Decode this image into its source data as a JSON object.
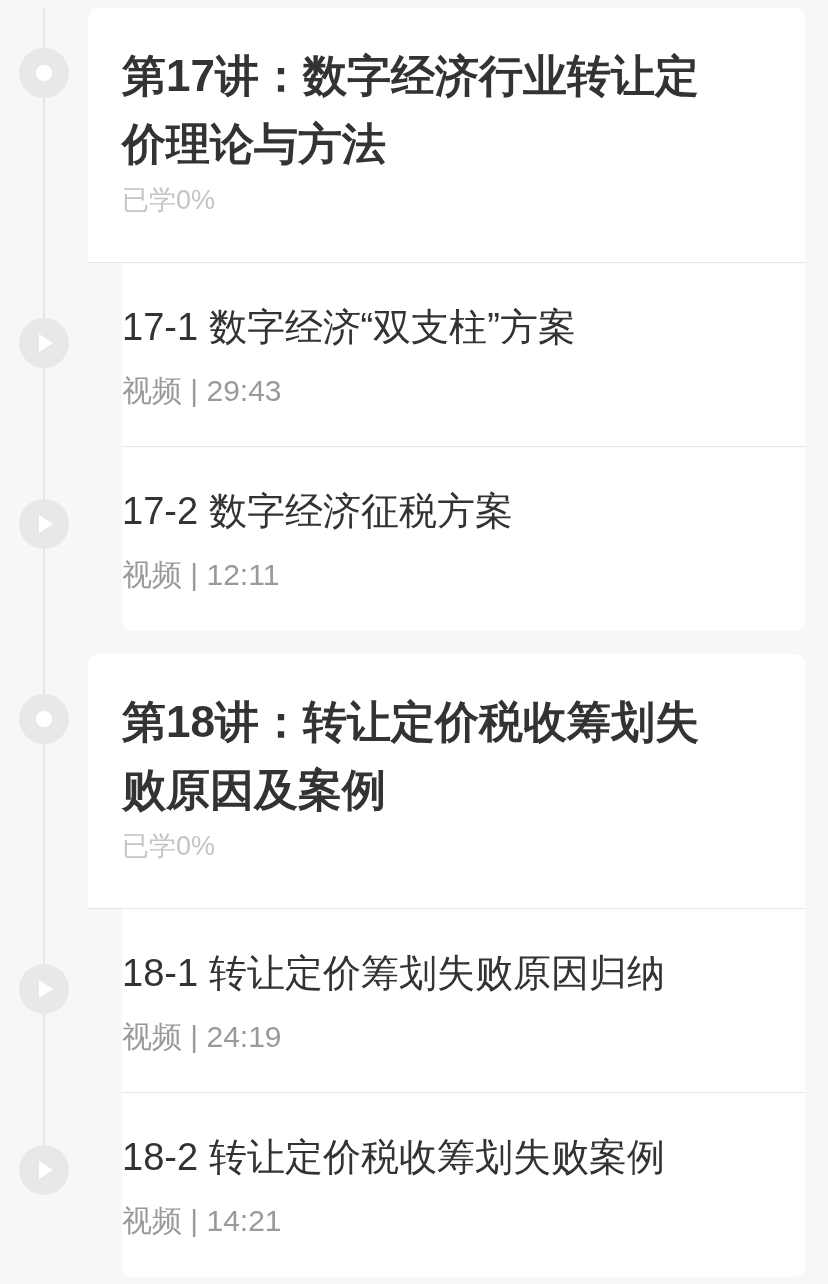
{
  "chapters": [
    {
      "title": "第17讲：数字经济行业转让定价理论与方法",
      "progress": "已学0%",
      "lessons": [
        {
          "title": "17-1 数字经济“双支柱”方案",
          "meta": "视频 | 29:43"
        },
        {
          "title": "17-2 数字经济征税方案",
          "meta": "视频 | 12:11"
        }
      ]
    },
    {
      "title": "第18讲：转让定价税收筹划失败原因及案例",
      "progress": "已学0%",
      "lessons": [
        {
          "title": "18-1 转让定价筹划失败原因归纳",
          "meta": "视频 | 24:19"
        },
        {
          "title": "18-2 转让定价税收筹划失败案例",
          "meta": "视频 | 14:21"
        }
      ]
    }
  ]
}
